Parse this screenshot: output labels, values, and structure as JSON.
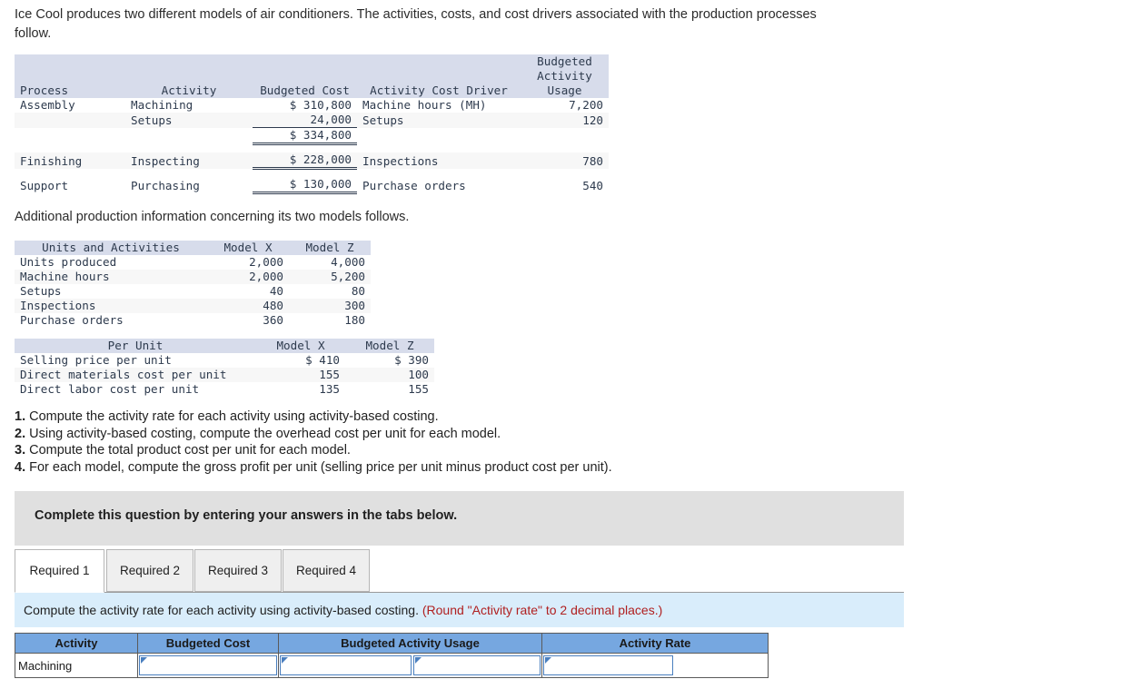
{
  "intro": {
    "paragraph": "Ice Cool produces two different models of air conditioners. The activities, costs, and cost drivers associated with the production processes follow.",
    "additional": "Additional production information concerning its two models follows."
  },
  "process_table": {
    "headers": {
      "process": "Process",
      "activity": "Activity",
      "budgeted_cost": "Budgeted Cost",
      "activity_cost_driver": "Activity Cost Driver",
      "usage_line1": "Budgeted",
      "usage_line2": "Activity",
      "usage_line3": "Usage"
    },
    "rows": [
      {
        "process": "Assembly",
        "activity": "Machining",
        "cost": "$ 310,800",
        "driver": "Machine hours (MH)",
        "usage": "7,200"
      },
      {
        "process": "",
        "activity": "Setups",
        "cost": "24,000",
        "driver": "Setups",
        "usage": "120"
      },
      {
        "process": "",
        "activity": "",
        "cost": "$ 334,800",
        "driver": "",
        "usage": ""
      },
      {
        "process": "Finishing",
        "activity": "Inspecting",
        "cost": "$ 228,000",
        "driver": "Inspections",
        "usage": "780"
      },
      {
        "process": "Support",
        "activity": "Purchasing",
        "cost": "$ 130,000",
        "driver": "Purchase orders",
        "usage": "540"
      }
    ]
  },
  "units_table": {
    "headers": [
      "Units and Activities",
      "Model X",
      "Model Z"
    ],
    "rows": [
      {
        "label": "Units produced",
        "model_x": "2,000",
        "model_z": "4,000"
      },
      {
        "label": "Machine hours",
        "model_x": "2,000",
        "model_z": "5,200"
      },
      {
        "label": "Setups",
        "model_x": "40",
        "model_z": "80"
      },
      {
        "label": "Inspections",
        "model_x": "480",
        "model_z": "300"
      },
      {
        "label": "Purchase orders",
        "model_x": "360",
        "model_z": "180"
      }
    ]
  },
  "perunit_table": {
    "headers": [
      "Per Unit",
      "Model X",
      "Model Z"
    ],
    "rows": [
      {
        "label": "Selling price per unit",
        "model_x": "$ 410",
        "model_z": "$ 390"
      },
      {
        "label": "Direct materials cost per unit",
        "model_x": "155",
        "model_z": "100"
      },
      {
        "label": "Direct labor cost per unit",
        "model_x": "135",
        "model_z": "155"
      }
    ]
  },
  "requirements": [
    {
      "num": "1.",
      "text": " Compute the activity rate for each activity using activity-based costing."
    },
    {
      "num": "2.",
      "text": " Using activity-based costing, compute the overhead cost per unit for each model."
    },
    {
      "num": "3.",
      "text": " Compute the total product cost per unit for each model."
    },
    {
      "num": "4.",
      "text": " For each model, compute the gross profit per unit (selling price per unit minus product cost per unit)."
    }
  ],
  "banner": {
    "text": "Complete this question by entering your answers in the tabs below."
  },
  "tabs": [
    {
      "label": "Required 1",
      "active": true
    },
    {
      "label": "Required 2",
      "active": false
    },
    {
      "label": "Required 3",
      "active": false
    },
    {
      "label": "Required 4",
      "active": false
    }
  ],
  "instruction": {
    "main": "Compute the activity rate for each activity using activity-based costing.",
    "round_note": " (Round \"Activity rate\" to 2 decimal places.)"
  },
  "answer_table": {
    "headers": [
      "Activity",
      "Budgeted Cost",
      "Budgeted Activity Usage",
      "Activity Rate"
    ],
    "rows": [
      {
        "activity": "Machining",
        "budgeted_cost": "",
        "usage_a": "",
        "usage_b": "",
        "rate_input": "",
        "rate_result": ""
      }
    ]
  },
  "colors": {
    "table_header_band": "#d7dceb",
    "answer_header_blue": "#76a7e0",
    "instruction_strip": "#d9edfb",
    "banner_gray": "#e0e0e0",
    "round_note_red": "#b02020",
    "input_border_blue": "#4a7fbf"
  }
}
